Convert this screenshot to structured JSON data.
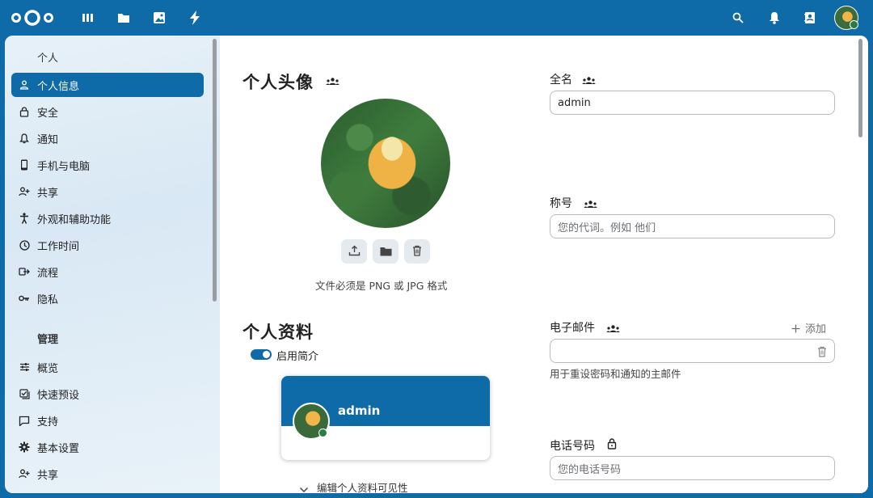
{
  "topbar": {
    "apps": [
      "dashboard-icon",
      "files-icon",
      "photos-icon",
      "activity-icon"
    ],
    "right_icons": [
      "search-icon",
      "bell-icon",
      "contacts-icon"
    ]
  },
  "sidebar": {
    "personal_heading": "个人",
    "personal_items": [
      {
        "label": "个人信息",
        "icon": "user-icon",
        "active": true
      },
      {
        "label": "安全",
        "icon": "lock-icon"
      },
      {
        "label": "通知",
        "icon": "bell-icon"
      },
      {
        "label": "手机与电脑",
        "icon": "phone-icon"
      },
      {
        "label": "共享",
        "icon": "share-icon"
      },
      {
        "label": "外观和辅助功能",
        "icon": "accessibility-icon"
      },
      {
        "label": "工作时间",
        "icon": "clock-icon"
      },
      {
        "label": "流程",
        "icon": "flow-icon"
      },
      {
        "label": "隐私",
        "icon": "key-icon"
      }
    ],
    "admin_heading": "管理",
    "admin_items": [
      {
        "label": "概览",
        "icon": "sliders-icon"
      },
      {
        "label": "快速预设",
        "icon": "checklist-icon"
      },
      {
        "label": "支持",
        "icon": "chat-icon"
      },
      {
        "label": "基本设置",
        "icon": "gear-icon"
      },
      {
        "label": "共享",
        "icon": "share-icon"
      }
    ]
  },
  "avatar_section": {
    "title": "个人头像",
    "hint": "文件必须是 PNG 或 JPG 格式"
  },
  "profile_section": {
    "title": "个人资料",
    "toggle_label": "启用简介",
    "card_name": "admin",
    "visibility_label": "编辑个人资料可见性"
  },
  "fields": {
    "fullname": {
      "label": "全名",
      "value": "admin"
    },
    "title": {
      "label": "称号",
      "placeholder": "您的代词。例如 他们"
    },
    "email": {
      "label": "电子邮件",
      "add_label": "添加",
      "hint": "用于重设密码和通知的主邮件"
    },
    "phone": {
      "label": "电话号码",
      "placeholder": "您的电话号码"
    }
  }
}
